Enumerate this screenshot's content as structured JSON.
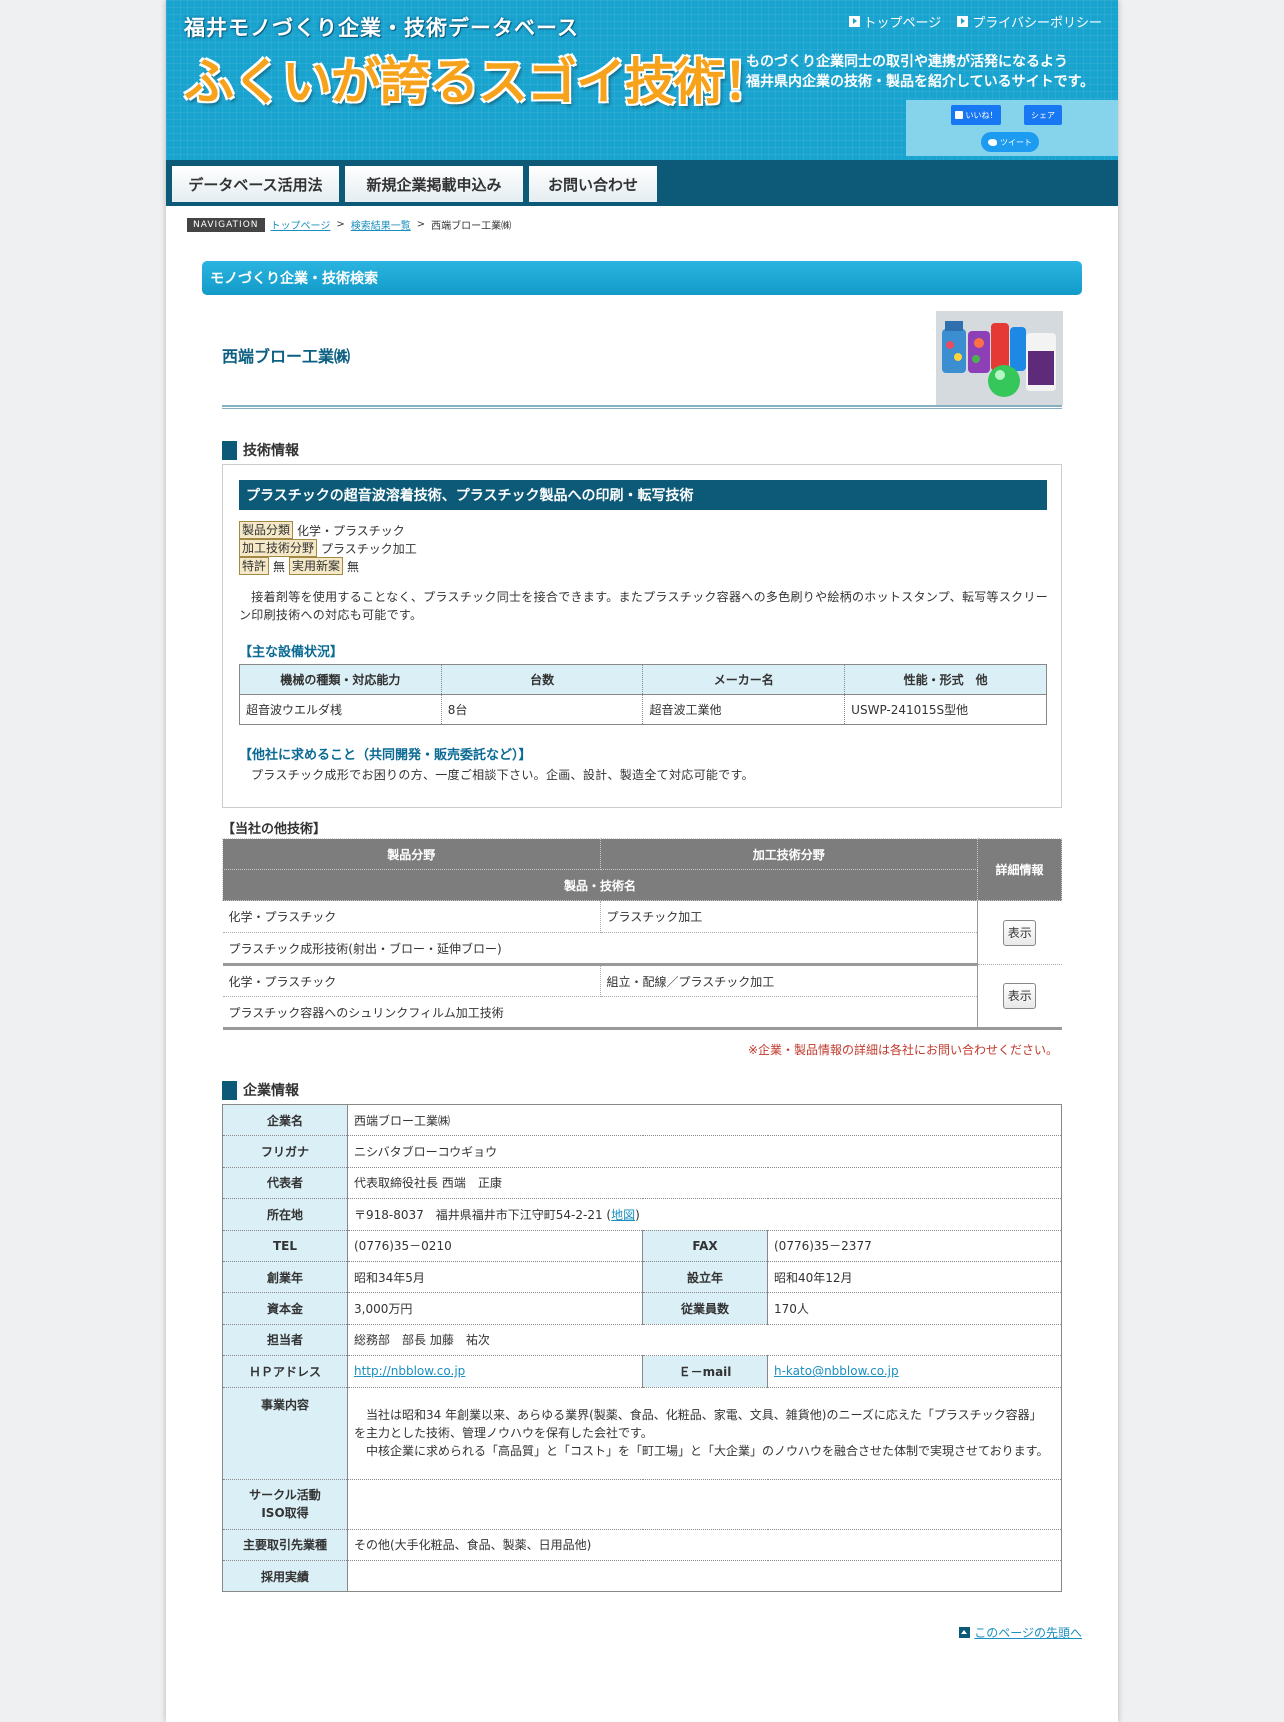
{
  "header": {
    "subtitle": "福井モノづくり企業・技術データベース",
    "title": "ふくいが誇るスゴイ技術！",
    "tagline_1": "ものづくり企業同士の取引や連携が活発になるよう",
    "tagline_2": "福井県内企業の技術・製品を紹介しているサイトです。",
    "top_links": [
      "トップページ",
      "プライバシーポリシー"
    ],
    "fb_like": "いいね！",
    "fb_share": "シェア",
    "tweet": "ツイート"
  },
  "nav": [
    "データベース活用法",
    "新規企業掲載申込み",
    "お問い合わせ"
  ],
  "breadcrumb": {
    "badge": "NAVIGATION",
    "home": "トップページ",
    "results": "検索結果一覧",
    "current": "西端ブロー工業㈱",
    "sep": ">"
  },
  "section_title": "モノづくり企業・技術検索",
  "company_name": "西端ブロー工業㈱",
  "tech": {
    "heading": "技術情報",
    "title": "プラスチックの超音波溶着技術、プラスチック製品への印刷・転写技術",
    "product_label": "製品分類",
    "product_value": "化学・プラスチック",
    "process_label": "加工技術分野",
    "process_value": "プラスチック加工",
    "patent_label": "特許",
    "patent_value": "無",
    "utility_label": "実用新案",
    "utility_value": "無",
    "description": "　接着剤等を使用することなく、プラスチック同士を接合できます。またプラスチック容器への多色刷りや絵柄のホットスタンプ、転写等スクリーン印刷技術への対応も可能です。",
    "equipment_heading": "【主な設備状況】",
    "equipment_headers": [
      "機械の種類・対応能力",
      "台数",
      "メーカー名",
      "性能・形式　他"
    ],
    "equipment_rows": [
      [
        "超音波ウエルダ桟",
        "8台",
        "超音波工業他",
        "USWP-241015S型他"
      ]
    ],
    "request_heading": "【他社に求めること（共同開発・販売委託など）】",
    "request_text": "プラスチック成形でお困りの方、一度ご相談下さい。企画、設計、製造全て対応可能です。"
  },
  "other_tech": {
    "heading": "【当社の他技術】",
    "headers": {
      "product": "製品分野",
      "process": "加工技術分野",
      "detail": "詳細情報",
      "name": "製品・技術名"
    },
    "rows": [
      {
        "product": "化学・プラスチック",
        "process": "プラスチック加工",
        "name": "プラスチック成形技術(射出・ブロー・延伸ブロー)",
        "button": "表示"
      },
      {
        "product": "化学・プラスチック",
        "process": "組立・配線／プラスチック加工",
        "name": "プラスチック容器へのシュリンクフィルム加工技術",
        "button": "表示"
      }
    ],
    "note": "※企業・製品情報の詳細は各社にお問い合わせください。"
  },
  "company": {
    "heading": "企業情報",
    "name_label": "企業名",
    "name": "西端ブロー工業㈱",
    "kana_label": "フリガナ",
    "kana": "ニシバタブローコウギョウ",
    "rep_label": "代表者",
    "rep": "代表取締役社長 西端　正康",
    "addr_label": "所在地",
    "addr": "〒918-8037　福井県福井市下江守町54-2-21 (",
    "map": "地図",
    "addr_close": ")",
    "tel_label": "TEL",
    "tel": "(0776)35－0210",
    "fax_label": "FAX",
    "fax": "(0776)35－2377",
    "founded_label": "創業年",
    "founded": "昭和34年5月",
    "est_label": "設立年",
    "est": "昭和40年12月",
    "capital_label": "資本金",
    "capital": "3,000万円",
    "employees_label": "従業員数",
    "employees": "170人",
    "contact_label": "担当者",
    "contact": "総務部　部長 加藤　祐次",
    "hp_label": "ＨＰアドレス",
    "hp": "http://nbblow.co.jp",
    "email_label": "Ｅ－mail",
    "email": "h-kato@nbblow.co.jp",
    "business_label": "事業内容",
    "business_1": "　当社は昭和34 年創業以来、あらゆる業界(製薬、食品、化粧品、家電、文具、雑貨他)のニーズに応えた「プラスチック容器」を主力とした技術、管理ノウハウを保有した会社です。",
    "business_2": "　中核企業に求められる「高品質」と「コスト」を「町工場」と「大企業」のノウハウを融合させた体制で実現させております。",
    "circle_label_1": "サークル活動",
    "circle_label_2": "ISO取得",
    "circle": "",
    "clients_label": "主要取引先業種",
    "clients": "その他(大手化粧品、食品、製薬、日用品他)",
    "hiring_label": "採用実績",
    "hiring": ""
  },
  "back_to_top": "このページの先頭へ"
}
